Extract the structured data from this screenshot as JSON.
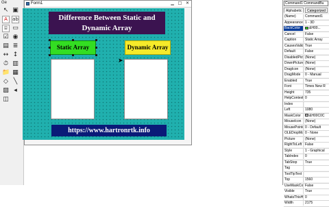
{
  "toolbox": {
    "title": "Ge",
    "icons": [
      "pointer-icon",
      "picturebox-icon",
      "label-icon",
      "textbox-icon",
      "frame-icon",
      "commandbutton-icon",
      "checkbox-icon",
      "optionbutton-icon",
      "combobox-icon",
      "listbox-icon",
      "hscrollbar-icon",
      "vscrollbar-icon",
      "timer-icon",
      "drivelistbox-icon",
      "dirlistbox-icon",
      "filelistbox-icon",
      "shape-icon",
      "line-icon",
      "image-icon",
      "data-icon",
      "ole-icon"
    ]
  },
  "form": {
    "title": "Form1",
    "banner_line1": "Difference Between Static  and",
    "banner_line2": "Dynamic Array",
    "static_button": "Static Array",
    "dynamic_button": "Dynamic Array",
    "url": "https://www.hartronrtk.info",
    "colors": {
      "canvas": "#20b0ae",
      "banner": "#3b1350",
      "static_button": "#33dd22",
      "dynamic_button": "#f5ea2a",
      "url_bar": "#0a1a78"
    }
  },
  "properties": {
    "object_combo": "Command1 CommandBu",
    "tab_alphabetic": "Alphabetic",
    "tab_categorized": "Categorized",
    "rows": [
      {
        "name": "(Name)",
        "value": "Command1"
      },
      {
        "name": "Appearance",
        "value": "1 - 3D"
      },
      {
        "name": "BackColor",
        "value": "&H00..."
      },
      {
        "name": "Cancel",
        "value": "False"
      },
      {
        "name": "Caption",
        "value": "Static Array"
      },
      {
        "name": "CausesValidati",
        "value": "True"
      },
      {
        "name": "Default",
        "value": "False"
      },
      {
        "name": "DisabledPicture",
        "value": "(None)"
      },
      {
        "name": "DownPicture",
        "value": "(None)"
      },
      {
        "name": "DragIcon",
        "value": "(None)"
      },
      {
        "name": "DragMode",
        "value": "0 - Manual"
      },
      {
        "name": "Enabled",
        "value": "True"
      },
      {
        "name": "Font",
        "value": "Times New R"
      },
      {
        "name": "Height",
        "value": "735"
      },
      {
        "name": "HelpContextID",
        "value": "0"
      },
      {
        "name": "Index",
        "value": ""
      },
      {
        "name": "Left",
        "value": "1080"
      },
      {
        "name": "MaskColor",
        "value": "&H00C0C"
      },
      {
        "name": "MouseIcon",
        "value": "(None)"
      },
      {
        "name": "MousePointer",
        "value": "0 - Default"
      },
      {
        "name": "OLEDropMode",
        "value": "0 - None"
      },
      {
        "name": "Picture",
        "value": "(None)"
      },
      {
        "name": "RightToLeft",
        "value": "False"
      },
      {
        "name": "Style",
        "value": "1 - Graphical"
      },
      {
        "name": "TabIndex",
        "value": "0"
      },
      {
        "name": "TabStop",
        "value": "True"
      },
      {
        "name": "Tag",
        "value": ""
      },
      {
        "name": "ToolTipText",
        "value": ""
      },
      {
        "name": "Top",
        "value": "1560"
      },
      {
        "name": "UseMaskColor",
        "value": "False"
      },
      {
        "name": "Visible",
        "value": "True"
      },
      {
        "name": "WhatsThisHelpI",
        "value": "0"
      },
      {
        "name": "Width",
        "value": "2175"
      }
    ],
    "backcolor_swatch": "#33dd22",
    "maskcolor_swatch": "#c0c0c0"
  }
}
